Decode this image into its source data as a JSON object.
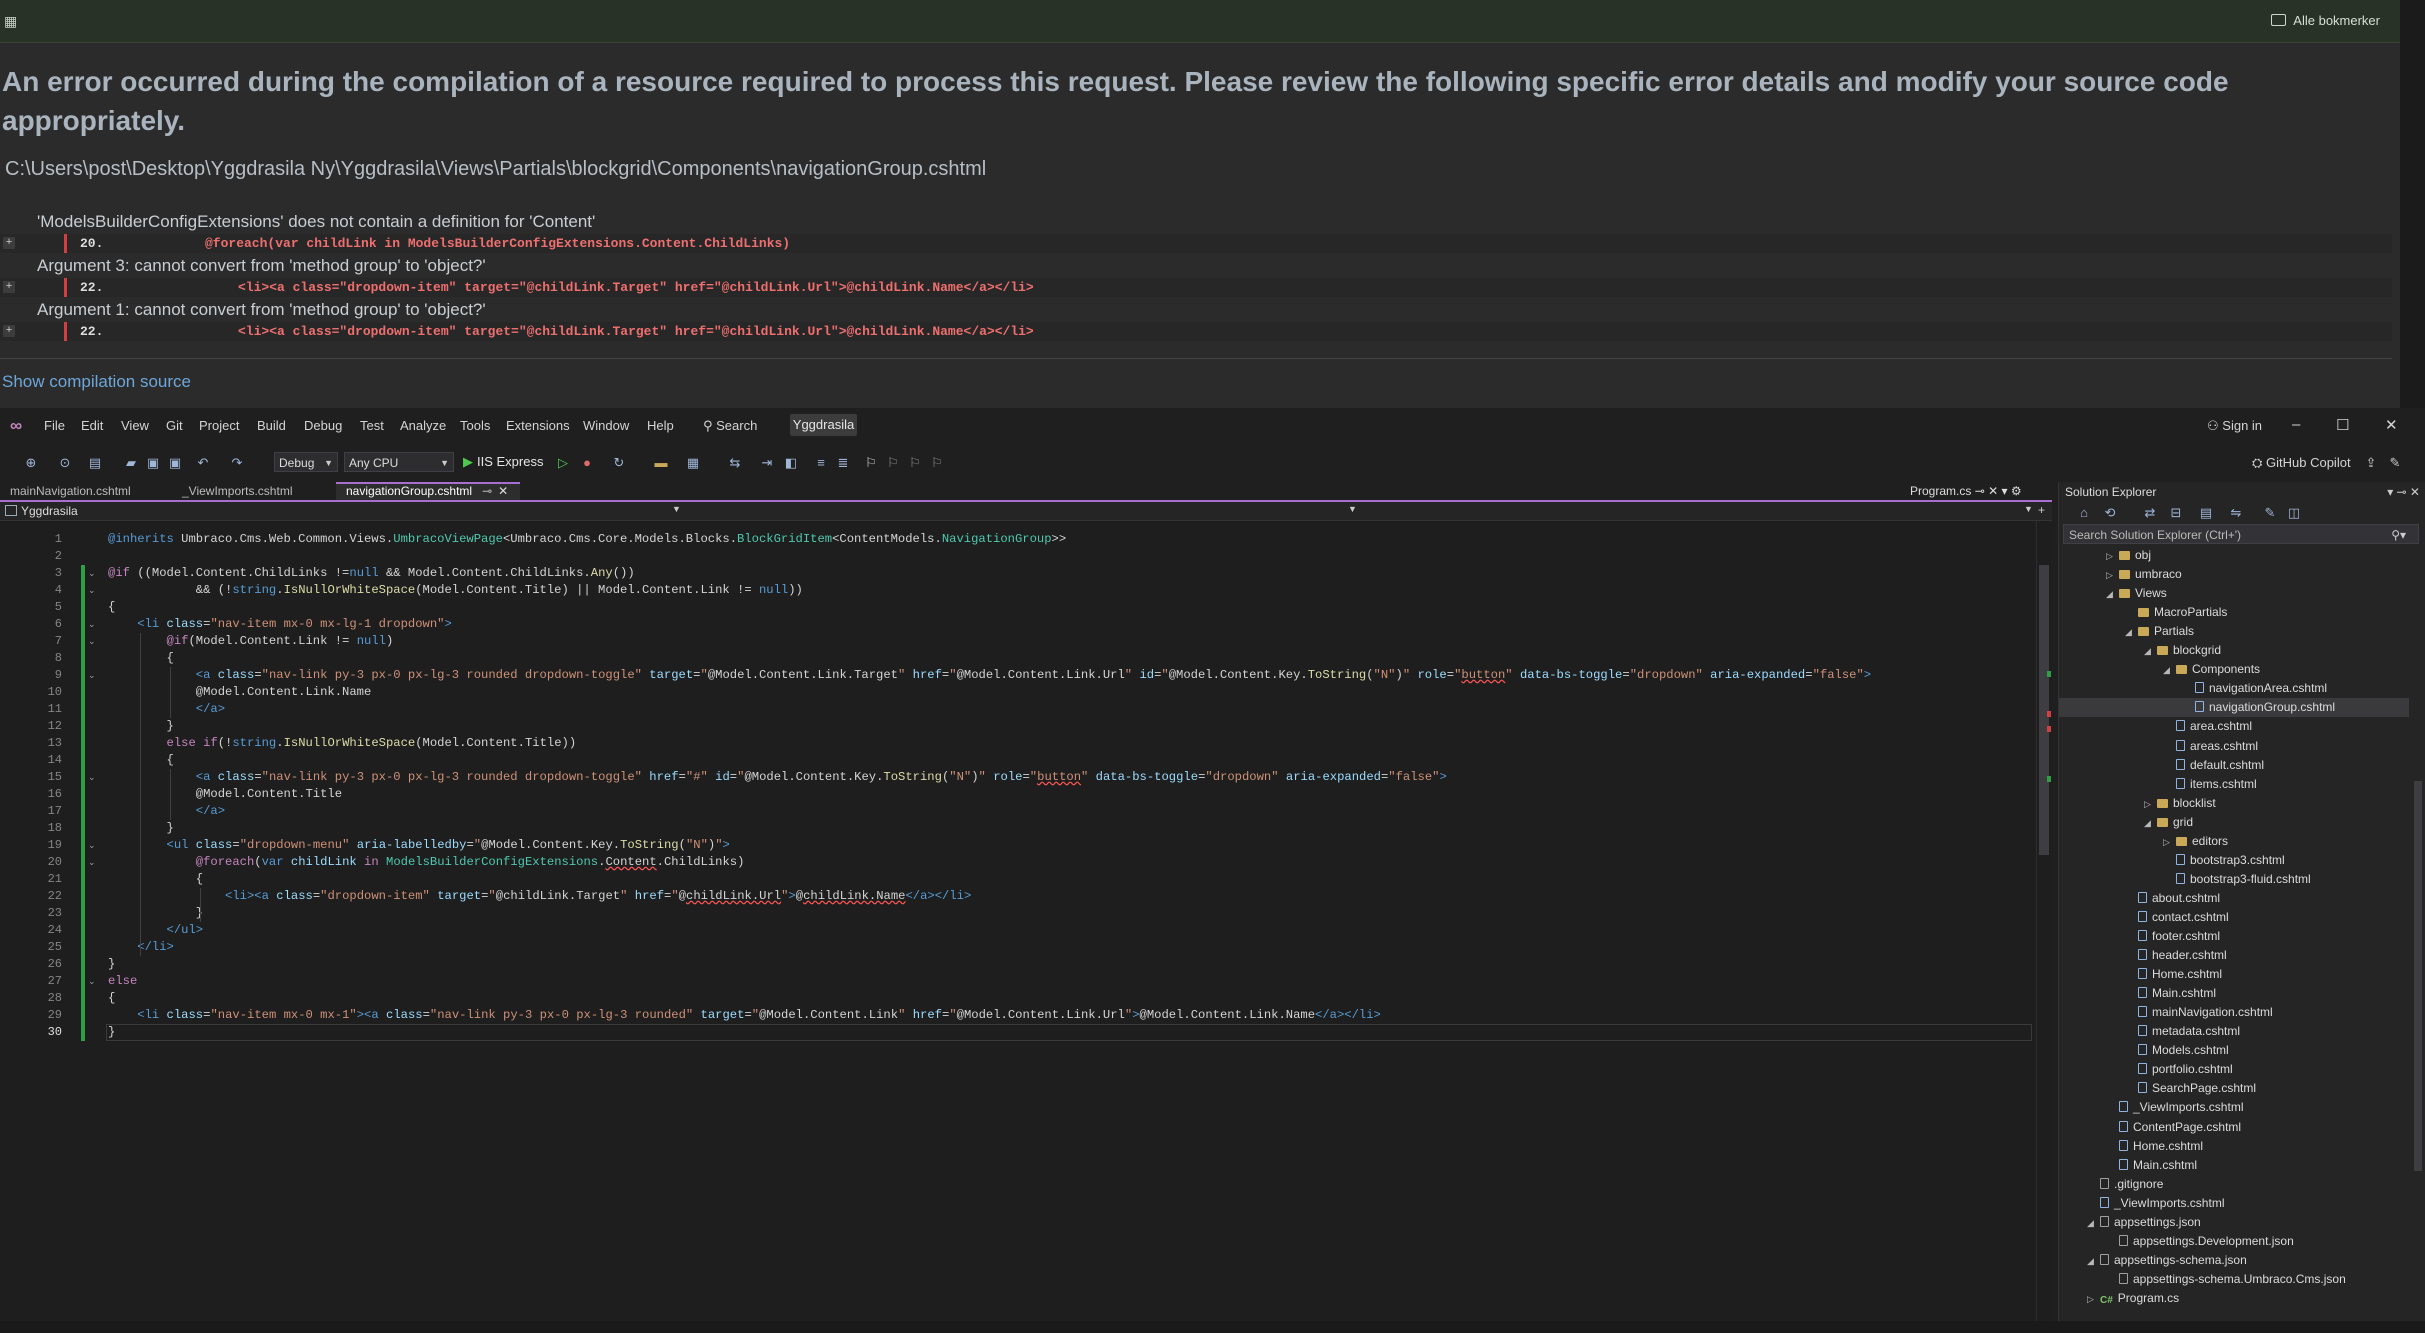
{
  "browser": {
    "bookmarks_label": "Alle bokmerker",
    "error_title": "An error occurred during the compilation of a resource required to process this request. Please review the following specific error details and modify your source code appropriately.",
    "file_path": "C:\\Users\\post\\Desktop\\Yggdrasila Ny\\Yggdrasila\\Views\\Partials\\blockgrid\\Components\\navigationGroup.cshtml",
    "errors": [
      {
        "message": "'ModelsBuilderConfigExtensions' does not contain a definition for 'Content'",
        "line": "20.",
        "code": "@foreach(var childLink in ModelsBuilderConfigExtensions.Content.ChildLinks)"
      },
      {
        "message": "Argument 3: cannot convert from 'method group' to 'object?'",
        "line": "22.",
        "code": "<li><a class=\"dropdown-item\" target=\"@childLink.Target\" href=\"@childLink.Url\">@childLink.Name</a></li>"
      },
      {
        "message": "Argument 1: cannot convert from 'method group' to 'object?'",
        "line": "22.",
        "code": "<li><a class=\"dropdown-item\" target=\"@childLink.Target\" href=\"@childLink.Url\">@childLink.Name</a></li>"
      }
    ],
    "show_source": "Show compilation source"
  },
  "vs": {
    "menu": [
      "File",
      "Edit",
      "View",
      "Git",
      "Project",
      "Build",
      "Debug",
      "Test",
      "Analyze",
      "Tools",
      "Extensions",
      "Window",
      "Help"
    ],
    "search": "Search",
    "solution_name": "Yggdrasila",
    "sign_in": "Sign in",
    "config": "Debug",
    "platform": "Any CPU",
    "run_target": "IIS Express",
    "copilot": "GitHub Copilot",
    "tabs": [
      {
        "label": "mainNavigation.cshtml"
      },
      {
        "label": "_ViewImports.cshtml"
      },
      {
        "label": "navigationGroup.cshtml"
      }
    ],
    "right_tab": "Program.cs",
    "nav_project": "Yggdrasila",
    "current_line": 30
  },
  "solution_explorer": {
    "title": "Solution Explorer",
    "search_placeholder": "Search Solution Explorer (Ctrl+')",
    "items": [
      {
        "label": "obj"
      },
      {
        "label": "umbraco"
      },
      {
        "label": "Views"
      },
      {
        "label": "MacroPartials"
      },
      {
        "label": "Partials"
      },
      {
        "label": "blockgrid"
      },
      {
        "label": "Components"
      },
      {
        "label": "navigationArea.cshtml"
      },
      {
        "label": "navigationGroup.cshtml"
      },
      {
        "label": "area.cshtml"
      },
      {
        "label": "areas.cshtml"
      },
      {
        "label": "default.cshtml"
      },
      {
        "label": "items.cshtml"
      },
      {
        "label": "blocklist"
      },
      {
        "label": "grid"
      },
      {
        "label": "editors"
      },
      {
        "label": "bootstrap3.cshtml"
      },
      {
        "label": "bootstrap3-fluid.cshtml"
      },
      {
        "label": "about.cshtml"
      },
      {
        "label": "contact.cshtml"
      },
      {
        "label": "footer.cshtml"
      },
      {
        "label": "header.cshtml"
      },
      {
        "label": "Home.cshtml"
      },
      {
        "label": "Main.cshtml"
      },
      {
        "label": "mainNavigation.cshtml"
      },
      {
        "label": "metadata.cshtml"
      },
      {
        "label": "Models.cshtml"
      },
      {
        "label": "portfolio.cshtml"
      },
      {
        "label": "SearchPage.cshtml"
      },
      {
        "label": "_ViewImports.cshtml"
      },
      {
        "label": "ContentPage.cshtml"
      },
      {
        "label": "Home.cshtml"
      },
      {
        "label": "Main.cshtml"
      },
      {
        "label": ".gitignore"
      },
      {
        "label": "_ViewImports.cshtml"
      },
      {
        "label": "appsettings.json"
      },
      {
        "label": "appsettings.Development.json"
      },
      {
        "label": "appsettings-schema.json"
      },
      {
        "label": "appsettings-schema.Umbraco.Cms.json"
      },
      {
        "label": "Program.cs"
      }
    ]
  },
  "colors": {
    "accent": "#a86fd2",
    "error_red": "#ef6f6f",
    "change_green": "#2e9f42",
    "link_blue": "#6ea6d8"
  }
}
